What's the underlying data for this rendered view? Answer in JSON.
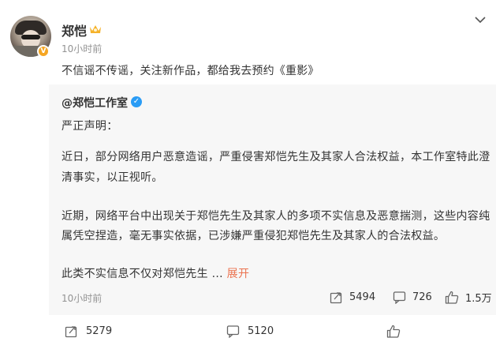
{
  "post": {
    "username": "郑恺",
    "time": "10小时前",
    "text": "不信谣不传谣，关注新作品，都给我去预约《重影》"
  },
  "repost": {
    "author": "@郑恺工作室",
    "lines": [
      "严正声明：",
      "近日，部分网络用户恶意造谣，严重侵害郑恺先生及其家人合法权益，本工作室特此澄",
      "清事实，以正视听。",
      "近期，网络平台中出现关于郑恺先生及其家人的多项不实信息及恶意揣测，这些内容纯",
      "属凭空捏造，毫无事实依据，已涉嫌严重侵犯郑恺先生及其家人的合法权益。",
      "此类不实信息不仅对郑恺先生 ..."
    ],
    "expand": "展开",
    "time": "10小时前",
    "shares": "5494",
    "comments": "726",
    "likes": "1.5万"
  },
  "footer": {
    "shares": "5279",
    "comments": "5120"
  },
  "colors": {
    "link": "#eb7350",
    "verified": "#2a9cf5",
    "vip": "#f5a623",
    "muted": "#939393"
  }
}
